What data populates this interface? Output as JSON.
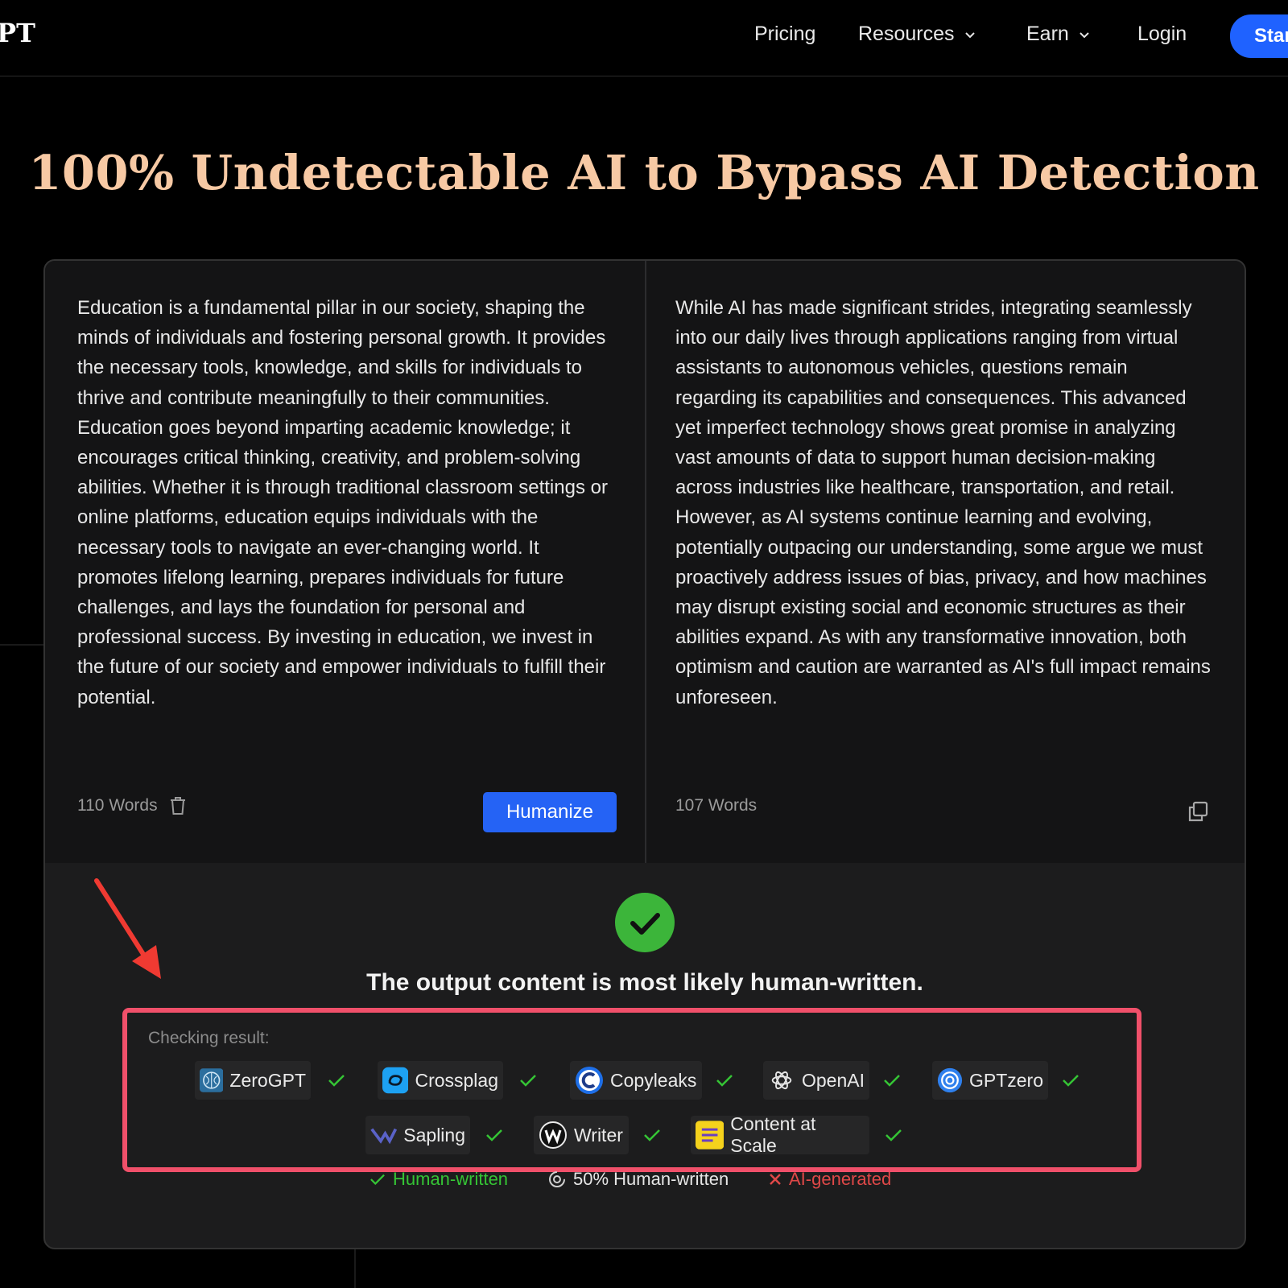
{
  "nav": {
    "logo": "PT",
    "pricing": "Pricing",
    "resources": "Resources",
    "earn": "Earn",
    "login": "Login",
    "start": "Star"
  },
  "hero": {
    "title": "100% Undetectable AI to Bypass AI Detection"
  },
  "input": {
    "text": "Education is a fundamental pillar in our society, shaping the minds of individuals and fostering personal growth. It provides the necessary tools, knowledge, and skills for individuals to thrive and contribute meaningfully to their communities. Education goes beyond imparting academic knowledge; it encourages critical thinking, creativity, and problem-solving abilities. Whether it is through traditional classroom settings or online platforms, education equips individuals with the necessary tools to navigate an ever-changing world. It promotes lifelong learning, prepares individuals for future challenges, and lays the foundation for personal and professional success. By investing in education, we invest in the future of our society and empower individuals to fulfill their potential.",
    "word_count": "110 Words",
    "humanize_label": "Humanize"
  },
  "output": {
    "text": "While AI has made significant strides, integrating seamlessly into our daily lives through applications ranging from virtual assistants to autonomous vehicles, questions remain regarding its capabilities and consequences. This advanced yet imperfect technology shows great promise in analyzing vast amounts of data to support human decision-making across industries like healthcare, transportation, and retail. However, as AI systems continue learning and evolving, potentially outpacing our understanding, some argue we must proactively address issues of bias, privacy, and how machines may disrupt existing social and economic structures as their abilities expand. As with any transformative innovation, both optimism and caution are warranted as AI's full impact remains unforeseen.",
    "word_count": "107 Words"
  },
  "result": {
    "title": "The output content is most likely human-written.",
    "checking_label": "Checking result:",
    "detectors": [
      {
        "name": "ZeroGPT",
        "status": "human"
      },
      {
        "name": "Crossplag",
        "status": "human"
      },
      {
        "name": "Copyleaks",
        "status": "human"
      },
      {
        "name": "OpenAI",
        "status": "human"
      },
      {
        "name": "GPTzero",
        "status": "human"
      },
      {
        "name": "Sapling",
        "status": "human"
      },
      {
        "name": "Writer",
        "status": "human"
      },
      {
        "name": "Content at Scale",
        "status": "human"
      }
    ]
  },
  "legend": {
    "human": "Human-written",
    "half": "50% Human-written",
    "ai": "AI-generated"
  },
  "colors": {
    "accent_blue": "#2563f5",
    "hero_title": "#f7c9a4",
    "success_green": "#3cb53a",
    "check_green": "#35c535",
    "ai_red": "#e04848",
    "highlight_border": "#f0506a"
  }
}
